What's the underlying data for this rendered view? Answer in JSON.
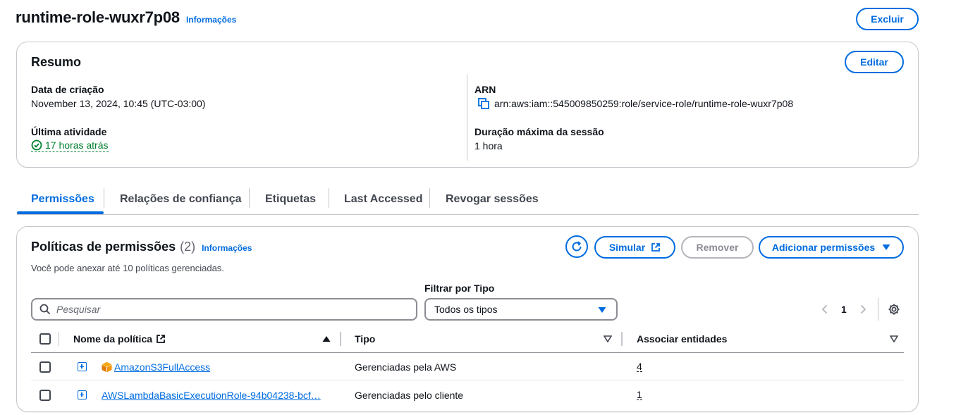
{
  "header": {
    "title": "runtime-role-wuxr7p08",
    "info_label": "Informações",
    "delete_label": "Excluir"
  },
  "summary": {
    "title": "Resumo",
    "edit_label": "Editar",
    "creation_date_label": "Data de criação",
    "creation_date_value": "November 13, 2024, 10:45 (UTC-03:00)",
    "last_activity_label": "Última atividade",
    "last_activity_value": "17 horas atrás",
    "arn_label": "ARN",
    "arn_value": "arn:aws:iam::545009850259:role/service-role/runtime-role-wuxr7p08",
    "max_session_label": "Duração máxima da sessão",
    "max_session_value": "1 hora"
  },
  "tabs": [
    {
      "label": "Permissões",
      "active": true
    },
    {
      "label": "Relações de confiança",
      "active": false
    },
    {
      "label": "Etiquetas",
      "active": false
    },
    {
      "label": "Last Accessed",
      "active": false
    },
    {
      "label": "Revogar sessões",
      "active": false
    }
  ],
  "policies": {
    "title": "Políticas de permissões",
    "count": "(2)",
    "info_label": "Informações",
    "subtitle": "Você pode anexar até 10 políticas gerenciadas.",
    "simulate_label": "Simular",
    "remove_label": "Remover",
    "add_label": "Adicionar permissões",
    "search_placeholder": "Pesquisar",
    "filter_label": "Filtrar por Tipo",
    "filter_value": "Todos os tipos",
    "page": "1",
    "columns": {
      "name": "Nome da política",
      "type": "Tipo",
      "entities": "Associar entidades"
    },
    "rows": [
      {
        "name": "AmazonS3FullAccess",
        "type": "Gerenciadas pela AWS",
        "entities": "4",
        "aws_managed": true
      },
      {
        "name": "AWSLambdaBasicExecutionRole-94b04238-bcf…",
        "type": "Gerenciadas pelo cliente",
        "entities": "1",
        "aws_managed": false
      }
    ]
  },
  "colors": {
    "accent": "#006ce0",
    "success": "#00802f",
    "border": "#c6c6cd"
  }
}
